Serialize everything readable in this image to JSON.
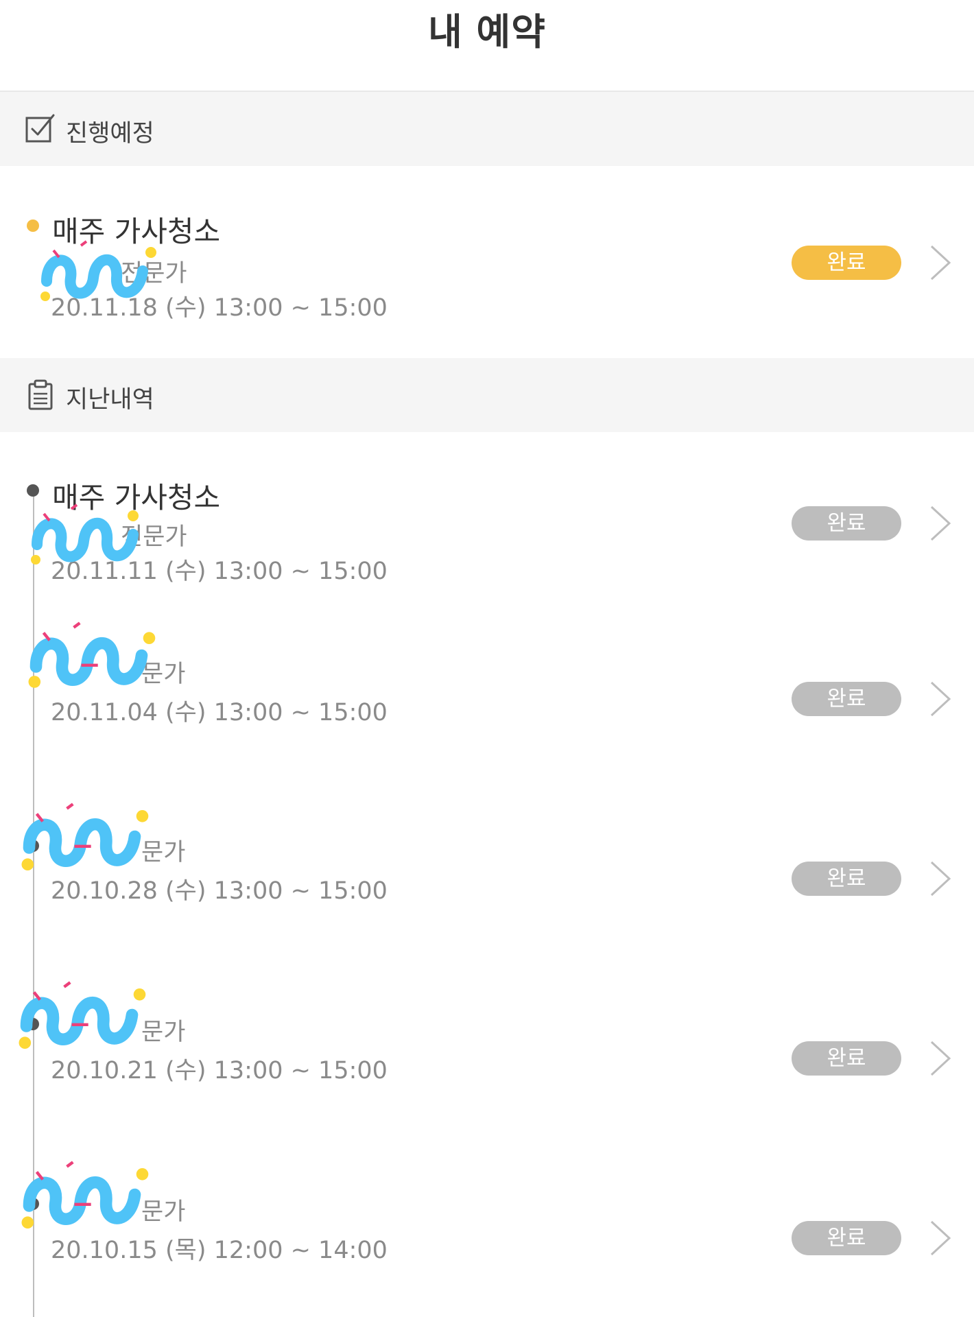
{
  "header": {
    "title": "내 예약"
  },
  "colors": {
    "accent": "#F5BE45",
    "inactive": "#BDBDBD",
    "past_dot": "#555555"
  },
  "upcoming": {
    "section_label": "진행예정",
    "section_icon": "checkbox-icon",
    "items": [
      {
        "title": "매주 가사청소",
        "role": "전문가",
        "date": "20.11.18 (수) 13:00 ~ 15:00",
        "status": "완료"
      }
    ]
  },
  "history": {
    "section_label": "지난내역",
    "section_icon": "clipboard-icon",
    "items": [
      {
        "title": "매주 가사청소",
        "role": "전문가",
        "date": "20.11.11 (수) 13:00 ~ 15:00",
        "status": "완료"
      },
      {
        "role": "문가",
        "date": "20.11.04 (수) 13:00 ~ 15:00",
        "status": "완료"
      },
      {
        "role": "문가",
        "date": "20.10.28 (수) 13:00 ~ 15:00",
        "status": "완료"
      },
      {
        "role": "문가",
        "date": "20.10.21 (수) 13:00 ~ 15:00",
        "status": "완료"
      },
      {
        "role": "문가",
        "date": "20.10.15 (목) 12:00 ~ 14:00",
        "status": "완료"
      }
    ]
  }
}
